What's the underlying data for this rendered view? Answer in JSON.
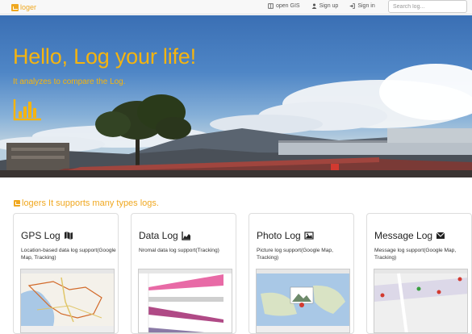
{
  "nav": {
    "brand": "loger",
    "links": [
      {
        "label": "open GIS",
        "icon": "book-icon"
      },
      {
        "label": "Sign up",
        "icon": "user-icon"
      },
      {
        "label": "Sign in",
        "icon": "sign-in-icon"
      }
    ],
    "search_placeholder": "Search log..."
  },
  "hero": {
    "title": "Hello, Log your life!",
    "subtitle": "It analyzes to compare the Log.",
    "icon": "bar-chart-icon"
  },
  "section": {
    "title": "logers It supports many types logs."
  },
  "cards": [
    {
      "title": "GPS Log",
      "icon": "map-icon",
      "description": "Location-based data log support(Google Map, Tracking)"
    },
    {
      "title": "Data Log",
      "icon": "area-chart-icon",
      "description": "Nromal data log support(Tracking)"
    },
    {
      "title": "Photo Log",
      "icon": "picture-icon",
      "description": "Picture log support(Google Map, Tracking)"
    },
    {
      "title": "Message Log",
      "icon": "envelope-icon",
      "description": "Message log support(Google Map, Tracking)"
    }
  ],
  "colors": {
    "accent": "#f0a820",
    "hero_text": "#f5b40f",
    "sky": "#4f86c6"
  }
}
